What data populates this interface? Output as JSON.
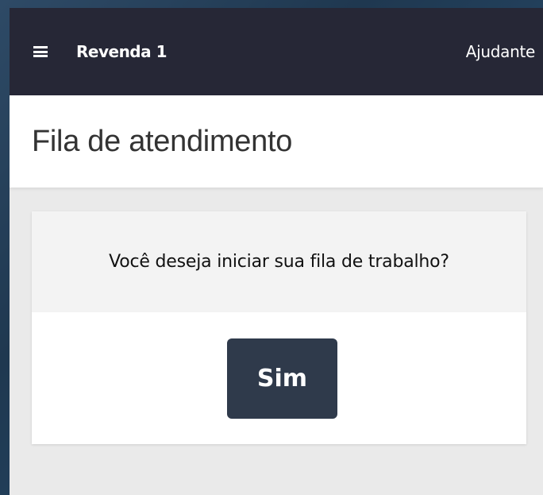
{
  "topbar": {
    "menu_icon": "hamburger-menu-icon",
    "store_name": "Revenda 1",
    "helper_link": "Ajudante",
    "background_color": "#262736"
  },
  "header": {
    "title": "Fila de atendimento"
  },
  "card": {
    "question": "Você deseja iniciar sua fila de trabalho?",
    "confirm_button": "Sim",
    "button_color": "#2f3a4b"
  }
}
